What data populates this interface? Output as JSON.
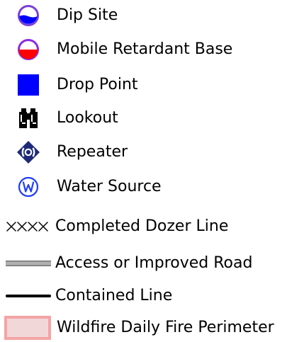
{
  "legend": {
    "items": [
      {
        "label": "Dip Site",
        "icon": "dip-site-icon"
      },
      {
        "label": "Mobile Retardant Base",
        "icon": "mobile-retardant-base-icon"
      },
      {
        "label": "Drop Point",
        "icon": "drop-point-icon"
      },
      {
        "label": "Lookout",
        "icon": "lookout-icon"
      },
      {
        "label": "Repeater",
        "icon": "repeater-icon"
      },
      {
        "label": "Water Source",
        "icon": "water-source-icon"
      },
      {
        "label": "Completed Dozer Line",
        "icon": "completed-dozer-line-icon"
      },
      {
        "label": "Access or Improved Road",
        "icon": "access-road-icon"
      },
      {
        "label": "Contained Line",
        "icon": "contained-line-icon"
      },
      {
        "label": "Wildfire Daily Fire Perimeter",
        "icon": "fire-perimeter-icon"
      }
    ],
    "colors": {
      "dip_site_blue": "#0000ff",
      "retardant_red": "#ff0000",
      "ring_purple": "#8a2be2",
      "drop_point_blue": "#0000ff",
      "repeater_navy": "#1e2a78",
      "water_source_blue": "#1e3cff",
      "road_gray": "#b0b0b0",
      "perimeter_fill": "#f2d7d9",
      "perimeter_border": "#f4a4a4"
    }
  }
}
